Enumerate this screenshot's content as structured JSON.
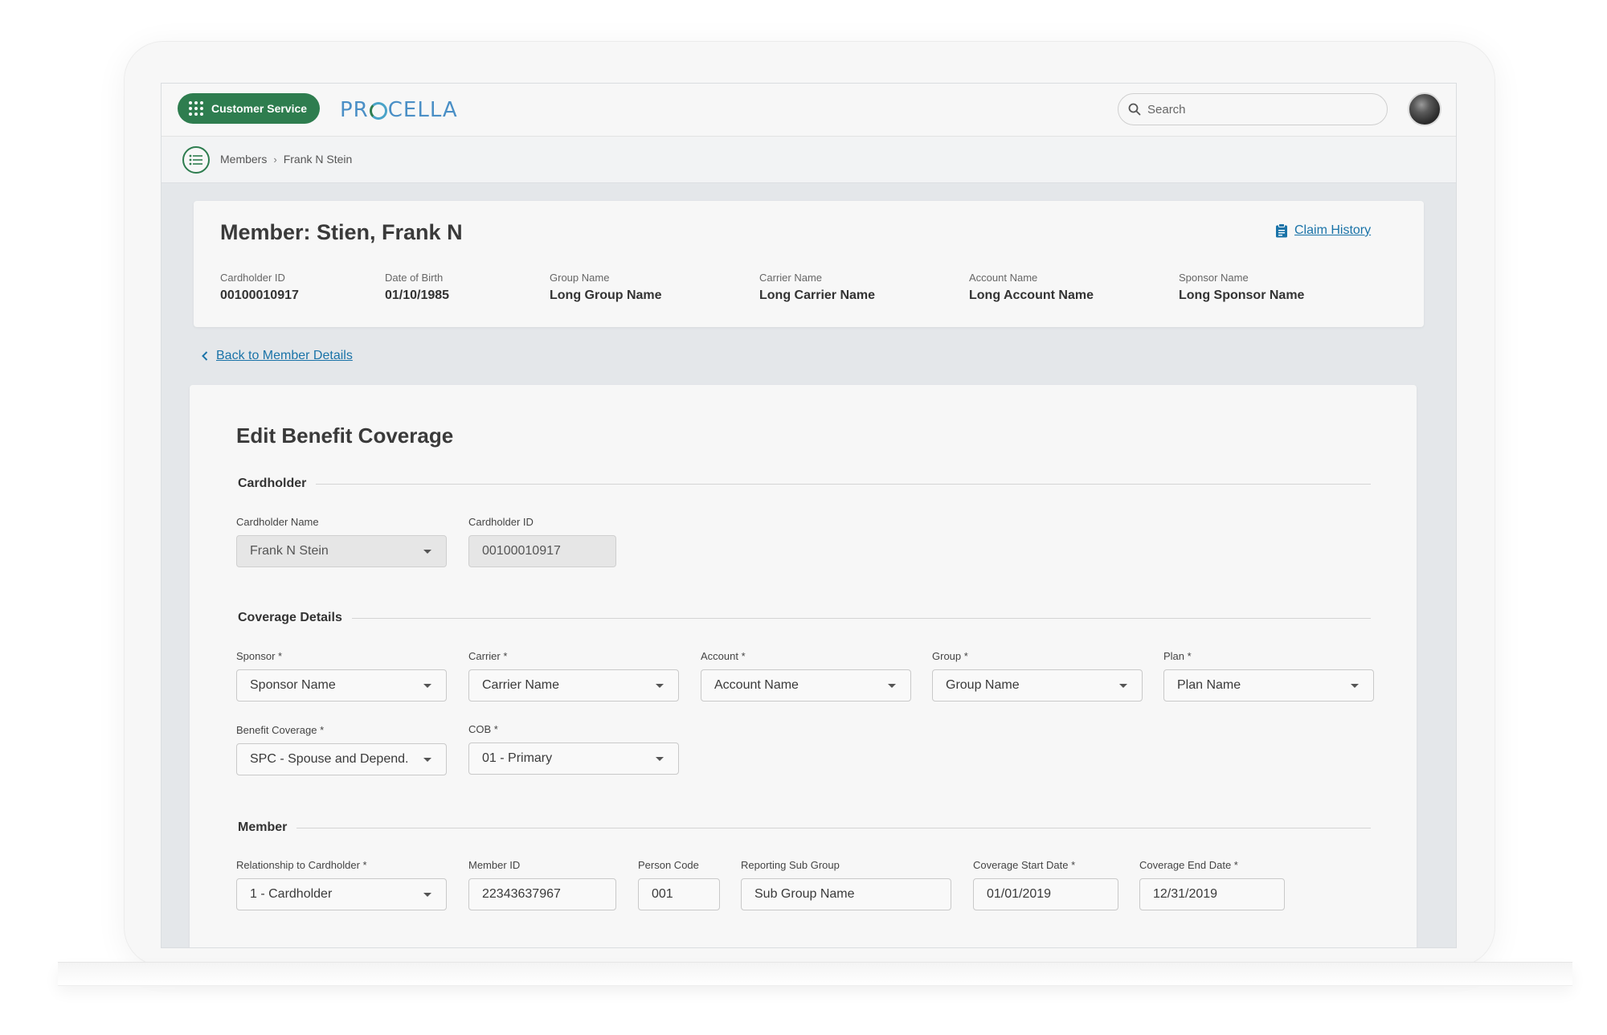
{
  "app": {
    "switcher_label": "Customer Service",
    "logo_text_a": "PR",
    "logo_text_b": "CELLA",
    "search_placeholder": "Search"
  },
  "breadcrumb": {
    "items": [
      "Members",
      "Frank N Stein"
    ],
    "separator": "›"
  },
  "member": {
    "title": "Member: Stien, Frank N",
    "claim_history_label": "Claim History",
    "fields": [
      {
        "label": "Cardholder ID",
        "value": "00100010917"
      },
      {
        "label": "Date of Birth",
        "value": "01/10/1985"
      },
      {
        "label": "Group Name",
        "value": "Long Group Name"
      },
      {
        "label": "Carrier Name",
        "value": "Long Carrier Name"
      },
      {
        "label": "Account Name",
        "value": "Long Account Name"
      },
      {
        "label": "Sponsor Name",
        "value": "Long Sponsor Name"
      }
    ]
  },
  "back_link_label": "Back to Member Details",
  "form": {
    "title": "Edit Benefit Coverage",
    "sections": {
      "cardholder": {
        "title": "Cardholder",
        "cardholder_name": {
          "label": "Cardholder Name",
          "value": "Frank N Stein"
        },
        "cardholder_id": {
          "label": "Cardholder ID",
          "value": "00100010917"
        }
      },
      "coverage": {
        "title": "Coverage Details",
        "sponsor": {
          "label": "Sponsor *",
          "value": "Sponsor Name"
        },
        "carrier": {
          "label": "Carrier *",
          "value": "Carrier Name"
        },
        "account": {
          "label": "Account *",
          "value": "Account Name"
        },
        "group": {
          "label": "Group *",
          "value": "Group Name"
        },
        "plan": {
          "label": "Plan *",
          "value": "Plan Name"
        },
        "benefit_coverage": {
          "label": "Benefit Coverage *",
          "value": "SPC - Spouse and Depend."
        },
        "cob": {
          "label": "COB *",
          "value": "01 - Primary"
        }
      },
      "member": {
        "title": "Member",
        "relationship": {
          "label": "Relationship to Cardholder *",
          "value": "1 - Cardholder"
        },
        "member_id": {
          "label": "Member ID",
          "value": "22343637967"
        },
        "person_code": {
          "label": "Person Code",
          "value": "001"
        },
        "reporting_sub_group": {
          "label": "Reporting Sub Group",
          "value": "Sub Group Name"
        },
        "coverage_start": {
          "label": "Coverage Start Date *",
          "value": "01/01/2019"
        },
        "coverage_end": {
          "label": "Coverage End Date *",
          "value": "12/31/2019"
        }
      }
    }
  },
  "colors": {
    "brand_green": "#2e7d4f",
    "link_blue": "#1a73a8",
    "logo_blue": "#4a8fc6"
  }
}
